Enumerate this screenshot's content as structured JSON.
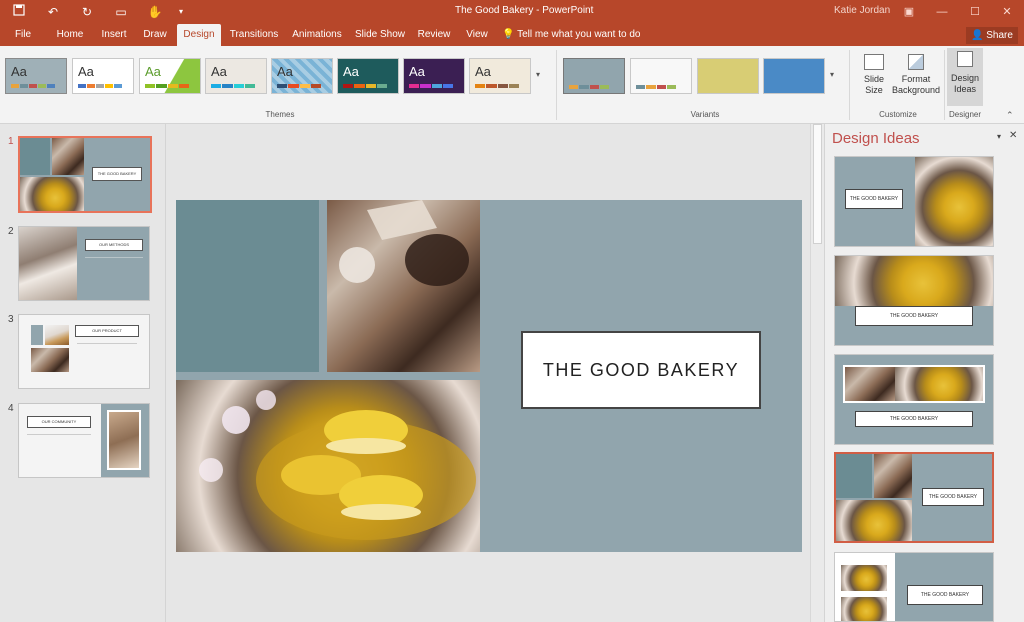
{
  "app": {
    "title": "The Good Bakery - PowerPoint",
    "user": "Katie Jordan"
  },
  "qat": {
    "save_icon": "save-icon",
    "undo_icon": "undo-icon",
    "redo_icon": "redo-icon"
  },
  "tabs": [
    {
      "label": "File"
    },
    {
      "label": "Home"
    },
    {
      "label": "Insert"
    },
    {
      "label": "Draw"
    },
    {
      "label": "Design"
    },
    {
      "label": "Transitions"
    },
    {
      "label": "Animations"
    },
    {
      "label": "Slide Show"
    },
    {
      "label": "Review"
    },
    {
      "label": "View"
    }
  ],
  "tellme": "Tell me what you want to do",
  "share": "Share",
  "ribbon": {
    "themes_label": "Themes",
    "variants_label": "Variants",
    "customize_label": "Customize",
    "designer_label": "Designer",
    "theme_glyph": "Aa",
    "slide_size": "Slide Size",
    "format_background": "Format Background",
    "design_ideas": "Design Ideas"
  },
  "slides": [
    {
      "num": "1",
      "title": "THE GOOD BAKERY"
    },
    {
      "num": "2",
      "title": "OUR METHODS"
    },
    {
      "num": "3",
      "title": "OUR PRODUCT"
    },
    {
      "num": "4",
      "title": "OUR COMMUNITY"
    }
  ],
  "main_slide": {
    "title": "THE GOOD BAKERY"
  },
  "design_pane": {
    "title": "Design Ideas",
    "ideas": [
      {
        "text": "THE GOOD BAKERY"
      },
      {
        "text": "THE GOOD BAKERY"
      },
      {
        "text": "THE GOOD BAKERY"
      },
      {
        "text": "THE GOOD BAKERY"
      },
      {
        "text": "THE GOOD BAKERY"
      }
    ]
  },
  "colors": {
    "accent": "#b7472a",
    "slide_bg": "#91a5ad",
    "teal_block": "#6b8c93"
  }
}
